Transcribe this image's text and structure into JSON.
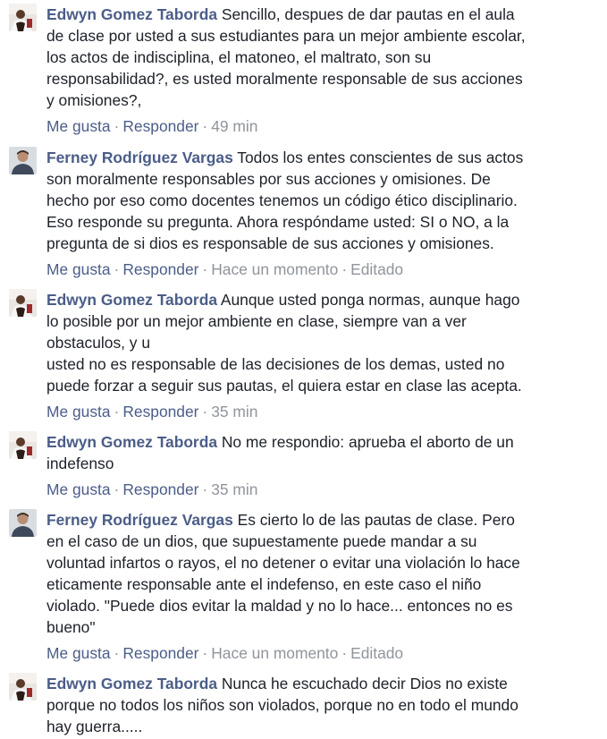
{
  "comments": [
    {
      "author": "Edwyn Gomez Taborda",
      "avatar_icon": "profile-photo-edwyn",
      "lines": [
        "Sencillo, despues de dar pautas en el aula",
        "de clase por usted a sus estudiantes para un mejor ambiente escolar,",
        "los actos de indisciplina, el matoneo, el maltrato, son su",
        "responsabilidad?, es usted moralmente responsable de sus acciones",
        "y omisiones?,"
      ],
      "like_label": "Me gusta",
      "reply_label": "Responder",
      "time": "49 min",
      "edited": ""
    },
    {
      "author": "Ferney Rodríguez Vargas",
      "avatar_icon": "profile-photo-ferney",
      "lines": [
        "Todos los entes conscientes de sus actos",
        "son moralmente responsables por sus acciones y omisiones. De",
        "hecho por eso como docentes tenemos un código ético disciplinario.",
        "Eso responde su pregunta. Ahora respóndame usted: SI o NO, a la",
        "pregunta de si dios es responsable de sus acciones y omisiones."
      ],
      "like_label": "Me gusta",
      "reply_label": "Responder",
      "time": "Hace un momento",
      "edited": "Editado"
    },
    {
      "author": "Edwyn Gomez Taborda",
      "avatar_icon": "profile-photo-edwyn",
      "lines": [
        "Aunque usted ponga normas, aunque hago",
        "lo posible por un mejor ambiente en clase, siempre van a ver",
        "obstaculos, y u",
        "usted no es responsable de las decisiones de los demas, usted no",
        "puede forzar a seguir sus pautas, el quiera estar en clase las acepta."
      ],
      "like_label": "Me gusta",
      "reply_label": "Responder",
      "time": "35 min",
      "edited": ""
    },
    {
      "author": "Edwyn Gomez Taborda",
      "avatar_icon": "profile-photo-edwyn",
      "lines": [
        "No me respondio: aprueba el aborto de un",
        "indefenso"
      ],
      "like_label": "Me gusta",
      "reply_label": "Responder",
      "time": "35 min",
      "edited": ""
    },
    {
      "author": "Ferney Rodríguez Vargas",
      "avatar_icon": "profile-photo-ferney",
      "lines": [
        "Es cierto lo de las pautas de clase. Pero",
        "en el caso de un dios, que supuestamente puede mandar a su",
        "voluntad infartos o rayos, el no detener o evitar una violación lo hace",
        "eticamente responsable ante el indefenso, en este caso el niño",
        "violado. \"Puede dios evitar la maldad y no lo hace... entonces no es",
        "bueno\""
      ],
      "like_label": "Me gusta",
      "reply_label": "Responder",
      "time": "Hace un momento",
      "edited": "Editado"
    },
    {
      "author": "Edwyn Gomez Taborda",
      "avatar_icon": "profile-photo-edwyn",
      "lines": [
        "Nunca he escuchado decir Dios no existe",
        "porque no todos los niños son violados, porque no en todo el mundo",
        "hay guerra....."
      ],
      "like_label": "",
      "reply_label": "",
      "time": "",
      "edited": ""
    }
  ],
  "colors": {
    "author": "#4b5d88",
    "text": "#1d2129",
    "meta": "#90949c",
    "background": "#ffffff"
  }
}
